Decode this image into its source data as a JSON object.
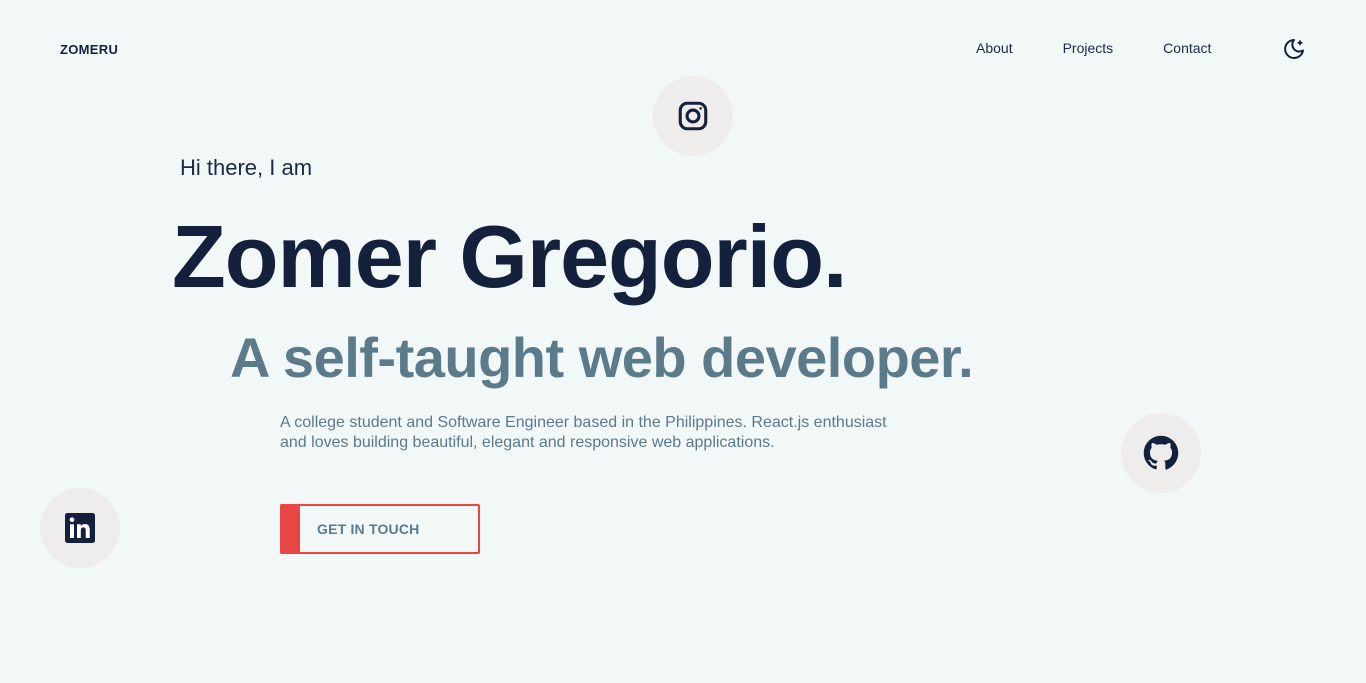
{
  "header": {
    "brand": "ZOMERU",
    "nav": [
      {
        "label": "About"
      },
      {
        "label": "Projects"
      },
      {
        "label": "Contact"
      }
    ],
    "theme_toggle_icon": "moon-stars-icon"
  },
  "hero": {
    "greeting": "Hi there, I am",
    "name": "Zomer Gregorio.",
    "tagline": "A self-taught web developer.",
    "intro": "A college student and Software Engineer based in the Philippines. React.js enthusiast and loves building beautiful, elegant and responsive web applications.",
    "cta_label": "GET IN TOUCH"
  },
  "social": [
    {
      "icon": "instagram-icon"
    },
    {
      "icon": "github-icon"
    },
    {
      "icon": "linkedin-icon"
    }
  ],
  "colors": {
    "background": "#f2f7f8",
    "primary_text": "#14213d",
    "secondary_text": "#5b7a8a",
    "accent": "#e84545",
    "social_bubble": "#eeedec"
  }
}
